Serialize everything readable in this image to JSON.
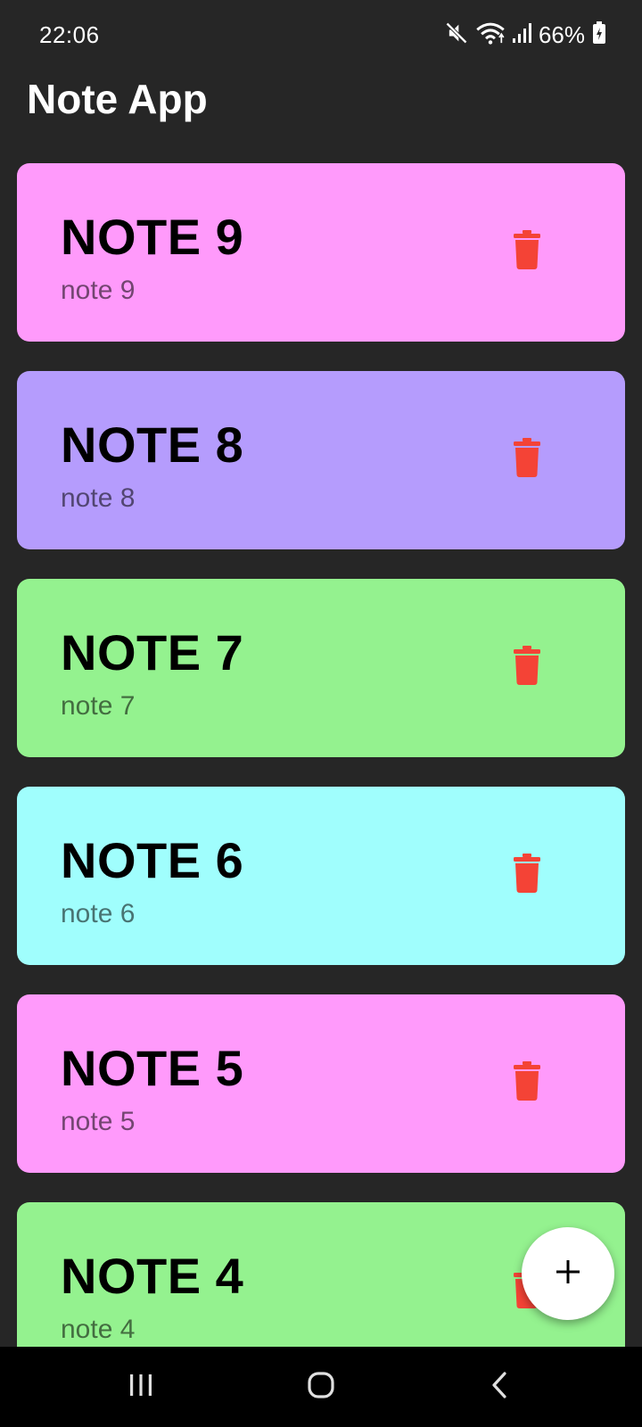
{
  "status_bar": {
    "time": "22:06",
    "battery": "66%",
    "icons": [
      "mute-icon",
      "wifi-icon",
      "signal-icon",
      "battery-icon"
    ]
  },
  "app": {
    "title": "Note App"
  },
  "notes": [
    {
      "title": "NOTE 9",
      "body": "note 9",
      "color": "#FF9AFB"
    },
    {
      "title": "NOTE 8",
      "body": "note 8",
      "color": "#B59CFD"
    },
    {
      "title": "NOTE 7",
      "body": "note 7",
      "color": "#94F28F"
    },
    {
      "title": "NOTE 6",
      "body": "note 6",
      "color": "#A0FEFD"
    },
    {
      "title": "NOTE 5",
      "body": "note 5",
      "color": "#FF9AFB"
    },
    {
      "title": "NOTE 4",
      "body": "note 4",
      "color": "#94F28F"
    }
  ],
  "colors": {
    "background": "#262626",
    "delete_icon": "#F44336",
    "fab_background": "#FFFFFF",
    "nav_bar": "#000000"
  },
  "fab": {
    "icon": "plus-icon"
  },
  "nav_bar": {
    "buttons": [
      "recents-icon",
      "home-icon",
      "back-icon"
    ]
  }
}
